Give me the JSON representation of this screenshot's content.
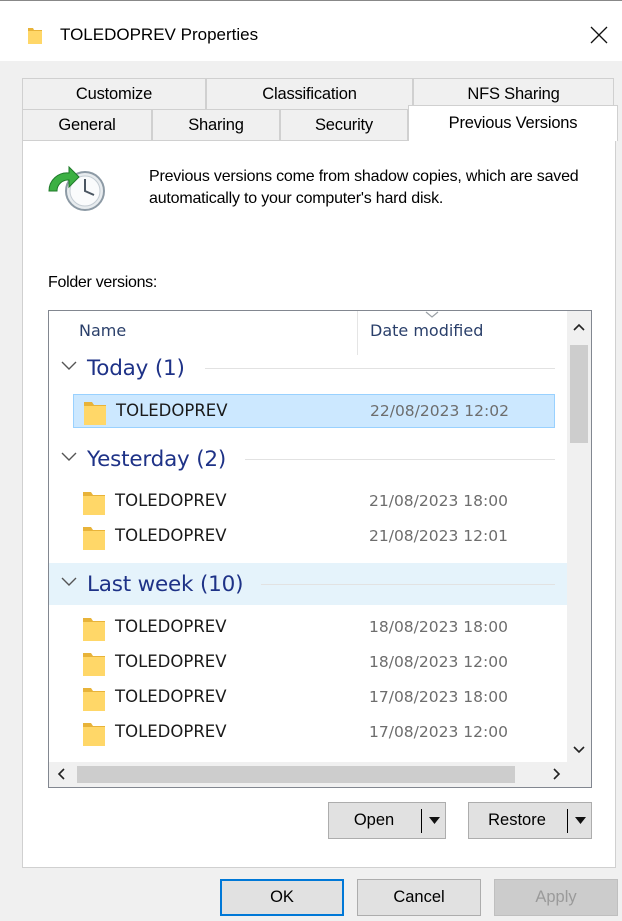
{
  "window": {
    "title": "TOLEDOPREV Properties",
    "close_icon": "close-icon"
  },
  "tabs": {
    "row1": [
      "Customize",
      "Classification",
      "NFS Sharing"
    ],
    "row2": [
      "General",
      "Sharing",
      "Security",
      "Previous Versions"
    ],
    "active": "Previous Versions"
  },
  "panel": {
    "description": "Previous versions come from shadow copies, which are saved automatically to your computer's hard disk.",
    "folder_versions_label": "Folder versions:"
  },
  "list": {
    "columns": [
      "Name",
      "Date modified"
    ],
    "groups": [
      {
        "label": "Today (1)",
        "items": [
          {
            "name": "TOLEDOPREV",
            "date": "22/08/2023 12:02",
            "selected": true
          }
        ]
      },
      {
        "label": "Yesterday (2)",
        "items": [
          {
            "name": "TOLEDOPREV",
            "date": "21/08/2023 18:00"
          },
          {
            "name": "TOLEDOPREV",
            "date": "21/08/2023 12:01"
          }
        ]
      },
      {
        "label": "Last week (10)",
        "highlighted": true,
        "items": [
          {
            "name": "TOLEDOPREV",
            "date": "18/08/2023 18:00"
          },
          {
            "name": "TOLEDOPREV",
            "date": "18/08/2023 12:00"
          },
          {
            "name": "TOLEDOPREV",
            "date": "17/08/2023 18:00"
          },
          {
            "name": "TOLEDOPREV",
            "date": "17/08/2023 12:00"
          }
        ]
      }
    ]
  },
  "actions": {
    "open_label": "Open",
    "restore_label": "Restore"
  },
  "footer": {
    "ok_label": "OK",
    "cancel_label": "Cancel",
    "apply_label": "Apply"
  },
  "colors": {
    "group_header": "#1e3287",
    "selection": "#cce8ff",
    "group_highlight": "#e5f3fb",
    "folder_yellow": "#ffd768",
    "default_button_border": "#0078d7"
  }
}
